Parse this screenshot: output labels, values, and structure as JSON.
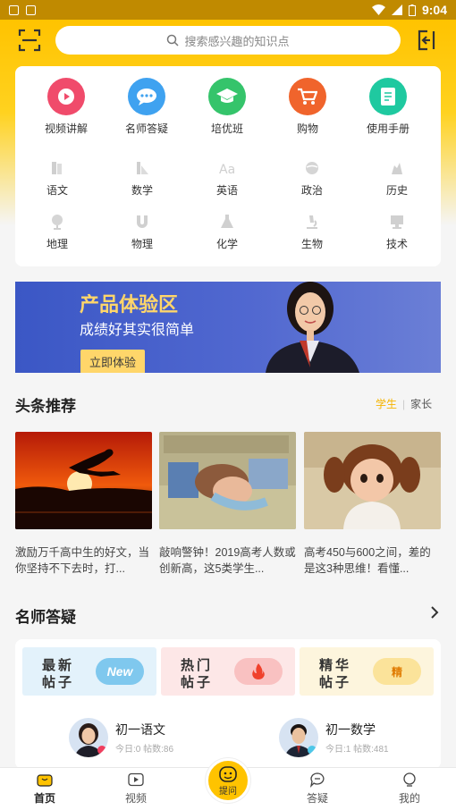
{
  "status_bar": {
    "time": "9:04"
  },
  "search": {
    "placeholder": "搜索感兴趣的知识点"
  },
  "features": [
    {
      "label": "视频讲解",
      "color": "#f04b6b",
      "icon": "play-icon"
    },
    {
      "label": "名师答疑",
      "color": "#3fa2f0",
      "icon": "chat-icon"
    },
    {
      "label": "培优班",
      "color": "#35c46b",
      "icon": "graduation-cap-icon"
    },
    {
      "label": "购物",
      "color": "#f0642c",
      "icon": "cart-icon"
    },
    {
      "label": "使用手册",
      "color": "#1fc9a0",
      "icon": "manual-icon"
    }
  ],
  "subjects": [
    {
      "label": "语文",
      "icon": "book-icon"
    },
    {
      "label": "数学",
      "icon": "ruler-icon"
    },
    {
      "label": "英语",
      "icon": "letters-icon"
    },
    {
      "label": "政治",
      "icon": "globe-icon"
    },
    {
      "label": "历史",
      "icon": "history-icon"
    },
    {
      "label": "地理",
      "icon": "globe-stand-icon"
    },
    {
      "label": "物理",
      "icon": "magnet-icon"
    },
    {
      "label": "化学",
      "icon": "flask-icon"
    },
    {
      "label": "生物",
      "icon": "microscope-icon"
    },
    {
      "label": "技术",
      "icon": "computer-icon"
    }
  ],
  "banner": {
    "title": "产品体验区",
    "subtitle": "成绩好其实很简单",
    "button": "立即体验"
  },
  "headlines": {
    "title": "头条推荐",
    "tab_student": "学生",
    "tab_parent": "家长",
    "items": [
      {
        "caption": "激励万千高中生的好文，当你坚持不下去时，打..."
      },
      {
        "caption": "敲响警钟！2019高考人数或创新高，这5类学生..."
      },
      {
        "caption": "高考450与600之间，差的是这3种思维！看懂..."
      }
    ]
  },
  "qa": {
    "title": "名师答疑",
    "tiles": [
      {
        "line1": "最新",
        "line2": "帖子",
        "badge": "New"
      },
      {
        "line1": "热门",
        "line2": "帖子",
        "badge": ""
      },
      {
        "line1": "精华",
        "line2": "帖子",
        "badge": "精"
      }
    ],
    "teachers": [
      {
        "name": "初一语文",
        "meta": "今日:0 帖数:86"
      },
      {
        "name": "初一数学",
        "meta": "今日:1 帖数:481"
      }
    ]
  },
  "nav": {
    "home": "首页",
    "video": "视频",
    "ask": "提问",
    "answers": "答疑",
    "mine": "我的"
  }
}
